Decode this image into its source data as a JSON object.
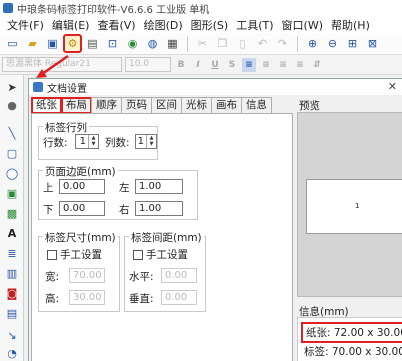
{
  "window": {
    "title": "中琅条码标签打印软件-V6.6.6 工业版 单机"
  },
  "menu": [
    "文件(F)",
    "编辑(E)",
    "查看(V)",
    "绘图(D)",
    "图形(S)",
    "工具(T)",
    "窗口(W)",
    "帮助(H)"
  ],
  "fontbar": {
    "font_name": "思源黑体 Regular21",
    "font_size": "10.0"
  },
  "dialog": {
    "title": "文档设置",
    "tabs": [
      "纸张",
      "布局",
      "顺序",
      "页码",
      "区间",
      "光标",
      "画布",
      "信息"
    ],
    "active_tab": "纸张",
    "rows_cols": {
      "group_label": "标签行列",
      "rows_label": "行数:",
      "rows_value": "1",
      "cols_label": "列数:",
      "cols_value": "1"
    },
    "margins": {
      "group_label": "页面边距(mm)",
      "top_label": "上",
      "top_value": "0.00",
      "left_label": "左",
      "left_value": "1.00",
      "bottom_label": "下",
      "bottom_value": "0.00",
      "right_label": "右",
      "right_value": "1.00"
    },
    "label_size": {
      "group_label": "标签尺寸(mm)",
      "manual_label": "手工设置",
      "width_label": "宽:",
      "width_value": "70.00",
      "height_label": "高:",
      "height_value": "30.00"
    },
    "label_gap": {
      "group_label": "标签间距(mm)",
      "manual_label": "手工设置",
      "h_label": "水平:",
      "h_value": "0.00",
      "v_label": "垂直:",
      "v_value": "0.00"
    },
    "preview_label": "预览",
    "preview_number": "1",
    "info_label": "信息(mm)",
    "info_paper": "纸张: 72.00 x 30.00",
    "info_label_size": "标签: 70.00 x 30.00"
  },
  "colors": {
    "highlight": "#e02020",
    "accent": "#2856a8"
  }
}
